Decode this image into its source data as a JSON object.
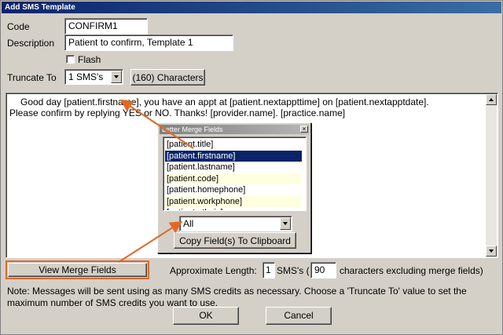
{
  "window": {
    "title": "Add SMS Template"
  },
  "form": {
    "code_label": "Code",
    "code_value": "CONFIRM1",
    "description_label": "Description",
    "description_value": "Patient to confirm, Template 1",
    "flash_label": "Flash",
    "flash_checked": false,
    "truncate_label": "Truncate To",
    "truncate_value": "1 SMS's",
    "characters_text": "(160) Characters"
  },
  "message": {
    "line1": "Good day  [patient.firstname], you have an appt at [patient.nextappttime] on [patient.nextapptdate].",
    "line2": "Please confirm by replying YES or NO. Thanks! [provider.name]. [practice.name]"
  },
  "merge_popup": {
    "title": "Letter Merge Fields",
    "close_glyph": "×",
    "fields": [
      {
        "label": "[patient.title]",
        "style": "plain"
      },
      {
        "label": "[patient.firstname]",
        "style": "selected"
      },
      {
        "label": "[patient.lastname]",
        "style": "plain"
      },
      {
        "label": "[patient.code]",
        "style": "alt"
      },
      {
        "label": "[patient.homephone]",
        "style": "plain"
      },
      {
        "label": "[patient.workphone]",
        "style": "alt"
      },
      {
        "label": "[patient.ethnic]",
        "style": "plain"
      }
    ],
    "filter_value": "All",
    "copy_button": "Copy Field(s) To Clipboard"
  },
  "bottom": {
    "view_merge_button": "View Merge Fields",
    "approx_label": "Approximate Length:",
    "sms_count": "1",
    "sms_label": "SMS's (",
    "char_count": "90",
    "char_label": "characters  excluding merge fields)"
  },
  "note": "Note: Messages will be sent using as many SMS credits as necessary. Choose a 'Truncate To' value to set the maximum number of SMS credits you want to use.",
  "buttons": {
    "ok": "OK",
    "cancel": "Cancel"
  },
  "colors": {
    "title_bar": "#0a246a",
    "annotation": "#e0692a",
    "selection": "#0a246a"
  }
}
